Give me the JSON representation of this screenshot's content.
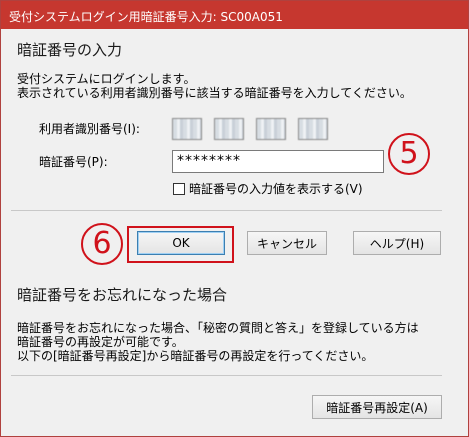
{
  "window": {
    "title": "受付システムログイン用暗証番号入力: SC00A051"
  },
  "main": {
    "heading": "暗証番号の入力",
    "intro_line1": "受付システムにログインします。",
    "intro_line2": "表示されている利用者識別番号に該当する暗証番号を入力してください。",
    "user_id_label": "利用者識別番号(I):",
    "user_id_segments": [
      "",
      "",
      "",
      ""
    ],
    "password_label": "暗証番号(P):",
    "password_value": "********",
    "show_password_label": "暗証番号の入力値を表示する(V)",
    "show_password_checked": false
  },
  "buttons": {
    "ok": "OK",
    "cancel": "キャンセル",
    "help": "ヘルプ(H)"
  },
  "forgot": {
    "heading": "暗証番号をお忘れになった場合",
    "line1": "暗証番号をお忘れになった場合、「秘密の質問と答え」を登録している方は",
    "line2": "暗証番号の再設定が可能です。",
    "line3": "以下の[暗証番号再設定]から暗証番号の再設定を行ってください。",
    "reset_button": "暗証番号再設定(A)"
  },
  "annotations": {
    "step5": "5",
    "step6": "6",
    "accent_color": "#d0121b"
  }
}
